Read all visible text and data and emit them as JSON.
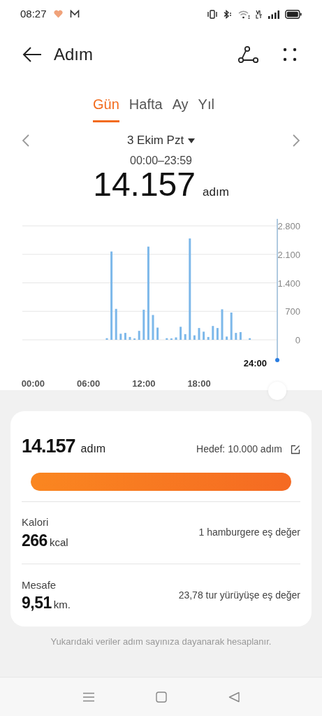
{
  "status_bar": {
    "time": "08:27"
  },
  "header": {
    "title": "Adım"
  },
  "tabs": [
    {
      "label": "Gün",
      "selected": true
    },
    {
      "label": "Hafta",
      "selected": false
    },
    {
      "label": "Ay",
      "selected": false
    },
    {
      "label": "Yıl",
      "selected": false
    }
  ],
  "date_nav": {
    "date": "3 Ekim Pzt",
    "time_range": "00:00–23:59"
  },
  "total": {
    "value": "14.157",
    "unit": "adım"
  },
  "chart": {
    "cursor_label": "24:00",
    "chart_data": {
      "type": "bar",
      "x": [
        8,
        8.5,
        9,
        9.5,
        10,
        10.5,
        11,
        11.5,
        12,
        12.5,
        13,
        13.5,
        14.5,
        15,
        15.5,
        16,
        16.5,
        17,
        17.5,
        18,
        18.5,
        19,
        19.5,
        20,
        20.5,
        21,
        21.5,
        22,
        22.5,
        23.5
      ],
      "xlim": [
        0,
        24
      ],
      "grid": true,
      "series": [
        {
          "color": "#7db8ea",
          "values": [
            40,
            2170,
            760,
            150,
            170,
            70,
            30,
            220,
            740,
            2290,
            610,
            300,
            40,
            20,
            60,
            320,
            140,
            2490,
            110,
            290,
            200,
            70,
            340,
            290,
            750,
            80,
            670,
            170,
            190,
            40
          ]
        }
      ],
      "ylim": [
        0,
        2800
      ],
      "yticks": [
        {
          "value": 0,
          "label": "0"
        },
        {
          "value": 700,
          "label": "700"
        },
        {
          "value": 1400,
          "label": "1.400"
        },
        {
          "value": 2100,
          "label": "2.100"
        },
        {
          "value": 2800,
          "label": "2.800"
        }
      ],
      "xticks": [
        {
          "value": 0,
          "label": "00:00"
        },
        {
          "value": 6,
          "label": "06:00"
        },
        {
          "value": 12,
          "label": "12:00"
        },
        {
          "value": 18,
          "label": "18:00"
        }
      ]
    }
  },
  "summary": {
    "steps": "14.157",
    "unit": "adım",
    "goal": "Hedef: 10.000 adım",
    "level": 1,
    "metrics": [
      {
        "label": "Kalori",
        "value": "266",
        "unit": "kcal",
        "comparison": "1 hamburgere eş değer"
      },
      {
        "label": "Mesafe",
        "value": "9,51",
        "unit": "km.",
        "comparison": "23,78 tur yürüyüşe eş değer"
      }
    ]
  },
  "footnote": "Yukarıdaki veriler adım sayınıza dayanarak hesaplanır."
}
